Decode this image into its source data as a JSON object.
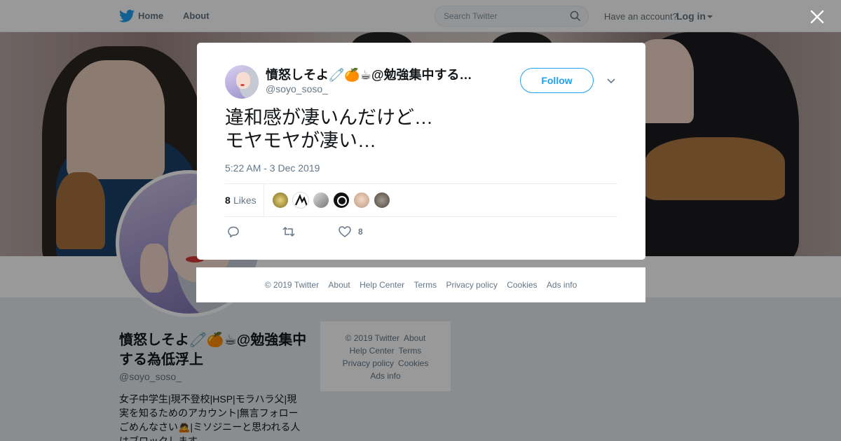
{
  "topbar": {
    "home": "Home",
    "about": "About",
    "search_placeholder": "Search Twitter",
    "have_account": "Have an account?",
    "login": "Log in"
  },
  "profile": {
    "name": "憤怒しそよ🧷🍊☕@勉強集中する為低浮上",
    "handle": "@soyo_soso_",
    "bio": "女子中学生|現不登校|HSP|モラハラ父|現実を知るためのアカウント|無言フォローごめんなさい🙇|ミソジニーと思われる人はブロックします"
  },
  "side_footer": {
    "copyright": "© 2019 Twitter",
    "about": "About",
    "help": "Help Center",
    "terms": "Terms",
    "privacy": "Privacy policy",
    "cookies": "Cookies",
    "ads": "Ads info"
  },
  "tweet": {
    "display_name": "憤怒しそよ🧷🍊☕@勉強集中する…",
    "handle": "@soyo_soso_",
    "follow_label": "Follow",
    "text": "違和感が凄いんだけど…\nモヤモヤが凄い…",
    "timestamp": "5:22 AM - 3 Dec 2019",
    "likes_count": "8",
    "likes_label": "Likes",
    "like_action_count": "8"
  },
  "card_footer": {
    "copyright": "© 2019 Twitter",
    "about": "About",
    "help": "Help Center",
    "terms": "Terms",
    "privacy": "Privacy policy",
    "cookies": "Cookies",
    "ads": "Ads info"
  },
  "icons": {
    "twitter_logo": "twitter-bird-icon",
    "search": "search-icon",
    "close": "close-icon",
    "chevron": "chevron-down-icon",
    "reply": "reply-icon",
    "retweet": "retweet-icon",
    "like": "heart-icon"
  },
  "colors": {
    "brand": "#1da1f2",
    "text": "#14171a",
    "muted": "#657786",
    "overlay": "rgba(0,0,0,0.4)"
  }
}
